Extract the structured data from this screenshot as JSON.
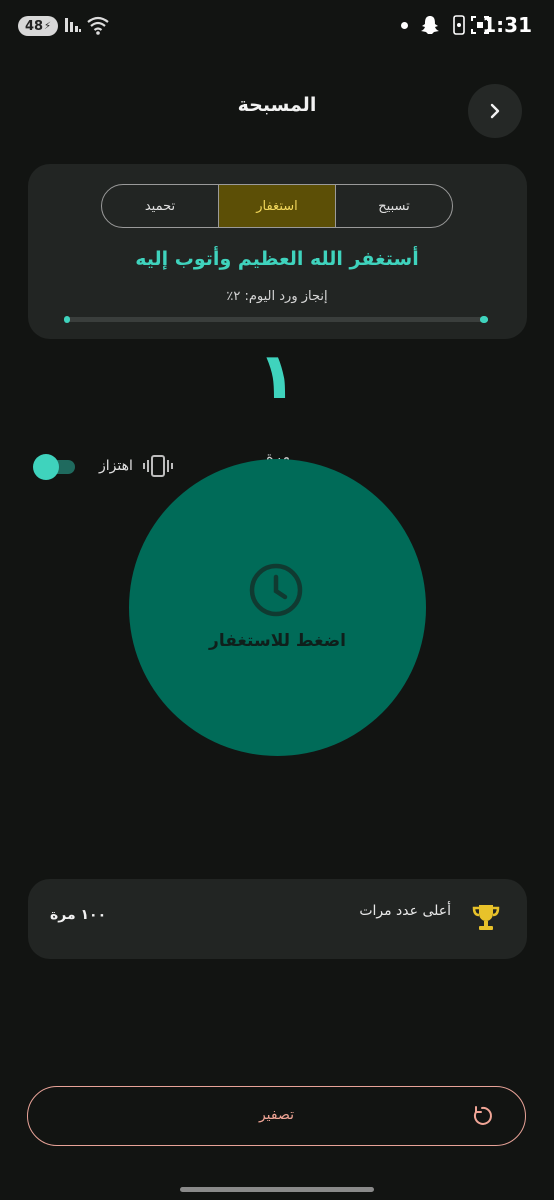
{
  "status_bar": {
    "battery": "48",
    "time": "1:31"
  },
  "header": {
    "title": "المسبحة",
    "back_icon": "chevron-right-icon"
  },
  "tabs": [
    {
      "label": "تسبيح",
      "active": false
    },
    {
      "label": "استغفار",
      "active": true
    },
    {
      "label": "تحميد",
      "active": false
    }
  ],
  "dhikr": {
    "text": "أستغفر الله العظيم وأتوب إليه",
    "progress_label": "إنجاز ورد اليوم: ٢٪",
    "progress_fraction": 0.02
  },
  "counter": {
    "value": "١",
    "unit": "مرة"
  },
  "vibration": {
    "label": "اهتزاز",
    "enabled": true
  },
  "tap_button": {
    "label": "اضغط للاستغفار",
    "icon": "clock-icon"
  },
  "best": {
    "label": "أعلى عدد مرات",
    "value": "١٠٠ مرة",
    "icon": "trophy-icon"
  },
  "reset": {
    "label": "تصفير",
    "icon": "reset-icon"
  },
  "colors": {
    "accent": "#3fd3bd",
    "tap_circle": "#006b58",
    "active_tab_bg": "#5c4f06",
    "active_tab_text": "#f1d65a",
    "reset_border": "#e8a398"
  }
}
